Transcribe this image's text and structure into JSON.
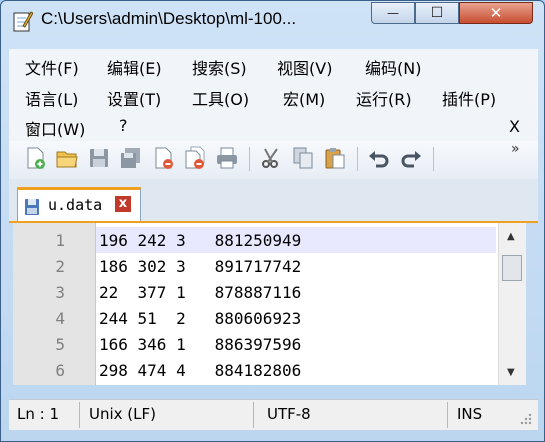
{
  "window": {
    "title": "C:\\Users\\admin\\Desktop\\ml-100...",
    "minimize_glyph": "—",
    "maximize_glyph": "☐",
    "close_glyph": "✕"
  },
  "menu": {
    "row1": [
      "文件(F)",
      "编辑(E)",
      "搜索(S)",
      "视图(V)",
      "编码(N)"
    ],
    "row2": [
      "语言(L)",
      "设置(T)",
      "工具(O)",
      "宏(M)",
      "运行(R)",
      "插件(P)"
    ],
    "row3": [
      "窗口(W)",
      "?"
    ],
    "close_doc": "X"
  },
  "toolbar": {
    "icons": [
      "new-file-icon",
      "open-file-icon",
      "save-icon",
      "save-all-icon",
      "close-icon",
      "close-all-icon",
      "print-icon",
      "cut-icon",
      "copy-icon",
      "paste-icon",
      "undo-icon",
      "redo-icon"
    ],
    "overflow": "»"
  },
  "tabs": [
    {
      "label": "u.data",
      "close": "x"
    }
  ],
  "editor": {
    "lines": [
      {
        "num": "1",
        "text": "196 242 3   881250949"
      },
      {
        "num": "2",
        "text": "186 302 3   891717742"
      },
      {
        "num": "3",
        "text": "22  377 1   878887116"
      },
      {
        "num": "4",
        "text": "244 51  2   880606923"
      },
      {
        "num": "5",
        "text": "166 346 1   886397596"
      },
      {
        "num": "6",
        "text": "298 474 4   884182806"
      }
    ]
  },
  "status": {
    "position": "Ln : 1",
    "eol": "Unix (LF)",
    "encoding": "UTF-8",
    "mode": "INS"
  },
  "colors": {
    "accent": "#f0a020",
    "current_line": "#e8e8ff",
    "close_button": "#c74e31"
  }
}
